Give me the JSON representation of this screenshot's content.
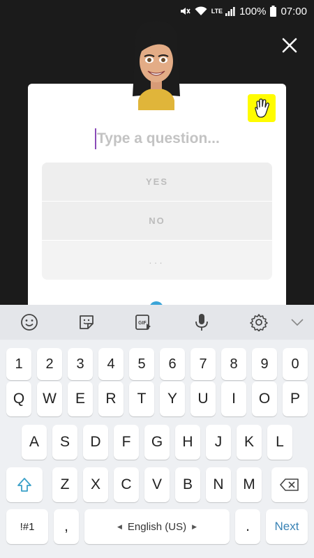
{
  "status_bar": {
    "network": "LTE",
    "battery": "100%",
    "time": "07:00"
  },
  "icons": {
    "close": "close-icon",
    "wave": "waving-hand-icon",
    "avatar": "bitmoji-avatar",
    "emoji": "emoji-icon",
    "sticker": "sticker-icon",
    "gif": "gif-icon",
    "mic": "microphone-icon",
    "settings": "gear-icon",
    "collapse": "chevron-down-icon",
    "shift": "shift-arrow-icon",
    "backspace": "backspace-icon"
  },
  "colors": {
    "accent_yellow": "#FFFC00",
    "caret": "#8a4bb8",
    "next_key": "#3a83b5"
  },
  "card": {
    "question_placeholder": "Type a question...",
    "options": [
      "YES",
      "NO",
      "..."
    ]
  },
  "keyboard": {
    "gif_label": "GIF",
    "row_numbers": [
      "1",
      "2",
      "3",
      "4",
      "5",
      "6",
      "7",
      "8",
      "9",
      "0"
    ],
    "row_top": [
      "Q",
      "W",
      "E",
      "R",
      "T",
      "Y",
      "U",
      "I",
      "O",
      "P"
    ],
    "row_mid": [
      "A",
      "S",
      "D",
      "F",
      "G",
      "H",
      "J",
      "K",
      "L"
    ],
    "row_bottom": [
      "Z",
      "X",
      "C",
      "V",
      "B",
      "N",
      "M"
    ],
    "symbols_key": "!#1",
    "comma_key": ",",
    "space_label": "English (US)",
    "period_key": ".",
    "next_key": "Next"
  }
}
